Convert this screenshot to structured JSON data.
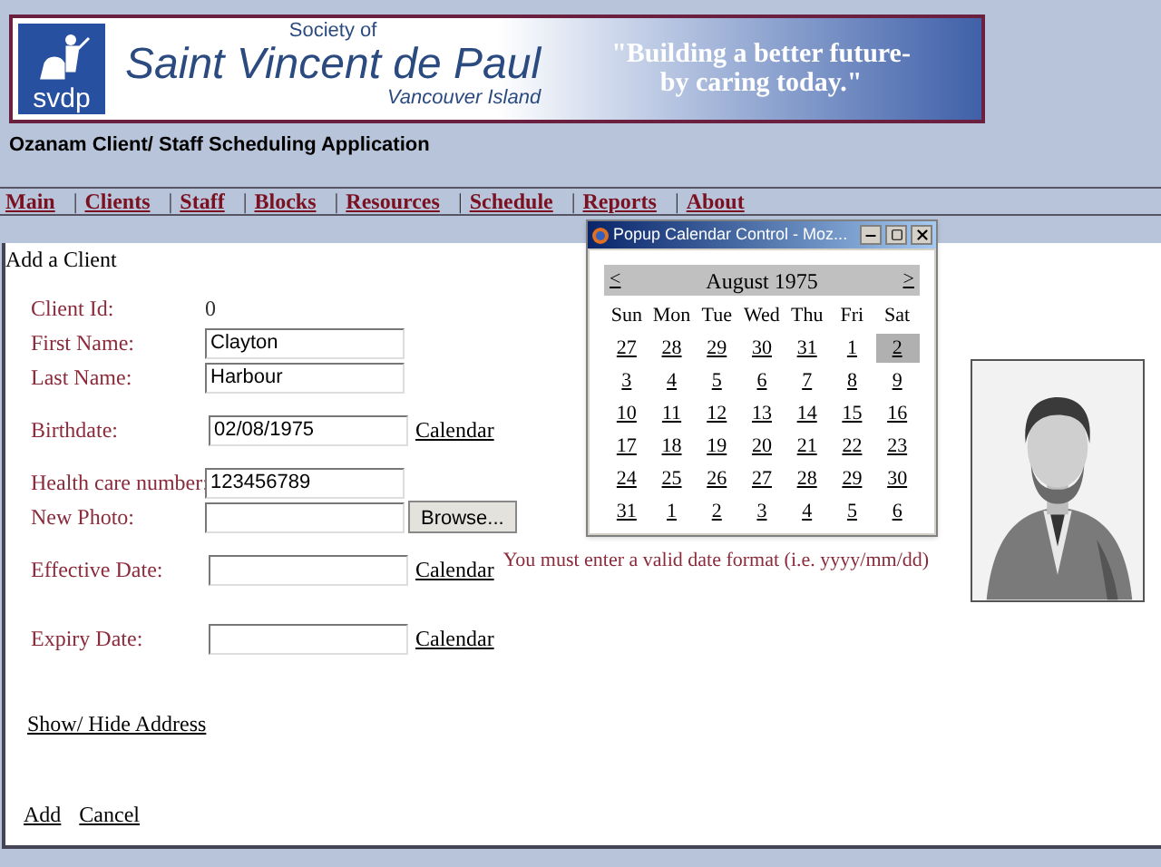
{
  "banner": {
    "logo_text": "svdp",
    "society_of": "Society of",
    "name": "Saint Vincent de Paul",
    "region": "Vancouver Island",
    "slogan_1": "\"Building a better future-",
    "slogan_2": "by caring today.\""
  },
  "app_title": "Ozanam Client/ Staff Scheduling Application",
  "nav": {
    "separator": "|",
    "items": [
      "Main",
      "Clients",
      "Staff",
      "Blocks",
      "Resources",
      "Schedule",
      "Reports",
      "About"
    ]
  },
  "page_heading": "Add a Client",
  "fields": [
    {
      "kind": "text",
      "label": "Client Id:",
      "value": "0"
    },
    {
      "kind": "input",
      "label": "First Name:",
      "value": "Clayton"
    },
    {
      "kind": "input",
      "label": "Last Name:",
      "value": "Harbour"
    },
    {
      "kind": "date",
      "label": "Birthdate:",
      "value": "02/08/1975",
      "link": "Calendar"
    },
    {
      "kind": "input",
      "label": "Health care number:",
      "value": "123456789"
    },
    {
      "kind": "file",
      "label": "New Photo:",
      "button": "Browse..."
    },
    {
      "kind": "date",
      "label": "Effective Date:",
      "link": "Calendar",
      "error": "You must enter a valid date format (i.e. yyyy/mm/dd)"
    },
    {
      "kind": "date",
      "label": "Expiry Date:",
      "link": "Calendar"
    }
  ],
  "address_toggle": "Show/ Hide Address",
  "actions": [
    "Add",
    "Cancel"
  ],
  "popup": {
    "title": "Popup Calendar Control - Moz...",
    "prev": "<",
    "month": "August 1975",
    "next": ">",
    "weekdays": [
      "Sun",
      "Mon",
      "Tue",
      "Wed",
      "Thu",
      "Fri",
      "Sat"
    ],
    "weeks": [
      [
        {
          "d": "27",
          "selected": false
        },
        {
          "d": "28",
          "selected": false
        },
        {
          "d": "29",
          "selected": false
        },
        {
          "d": "30",
          "selected": false
        },
        {
          "d": "31",
          "selected": false
        },
        {
          "d": "1",
          "selected": false
        },
        {
          "d": "2",
          "selected": true
        }
      ],
      [
        {
          "d": "3",
          "selected": false
        },
        {
          "d": "4",
          "selected": false
        },
        {
          "d": "5",
          "selected": false
        },
        {
          "d": "6",
          "selected": false
        },
        {
          "d": "7",
          "selected": false
        },
        {
          "d": "8",
          "selected": false
        },
        {
          "d": "9",
          "selected": false
        }
      ],
      [
        {
          "d": "10",
          "selected": false
        },
        {
          "d": "11",
          "selected": false
        },
        {
          "d": "12",
          "selected": false
        },
        {
          "d": "13",
          "selected": false
        },
        {
          "d": "14",
          "selected": false
        },
        {
          "d": "15",
          "selected": false
        },
        {
          "d": "16",
          "selected": false
        }
      ],
      [
        {
          "d": "17",
          "selected": false
        },
        {
          "d": "18",
          "selected": false
        },
        {
          "d": "19",
          "selected": false
        },
        {
          "d": "20",
          "selected": false
        },
        {
          "d": "21",
          "selected": false
        },
        {
          "d": "22",
          "selected": false
        },
        {
          "d": "23",
          "selected": false
        }
      ],
      [
        {
          "d": "24",
          "selected": false
        },
        {
          "d": "25",
          "selected": false
        },
        {
          "d": "26",
          "selected": false
        },
        {
          "d": "27",
          "selected": false
        },
        {
          "d": "28",
          "selected": false
        },
        {
          "d": "29",
          "selected": false
        },
        {
          "d": "30",
          "selected": false
        }
      ],
      [
        {
          "d": "31",
          "selected": false
        },
        {
          "d": "1",
          "selected": false
        },
        {
          "d": "2",
          "selected": false
        },
        {
          "d": "3",
          "selected": false
        },
        {
          "d": "4",
          "selected": false
        },
        {
          "d": "5",
          "selected": false
        },
        {
          "d": "6",
          "selected": false
        }
      ]
    ]
  }
}
